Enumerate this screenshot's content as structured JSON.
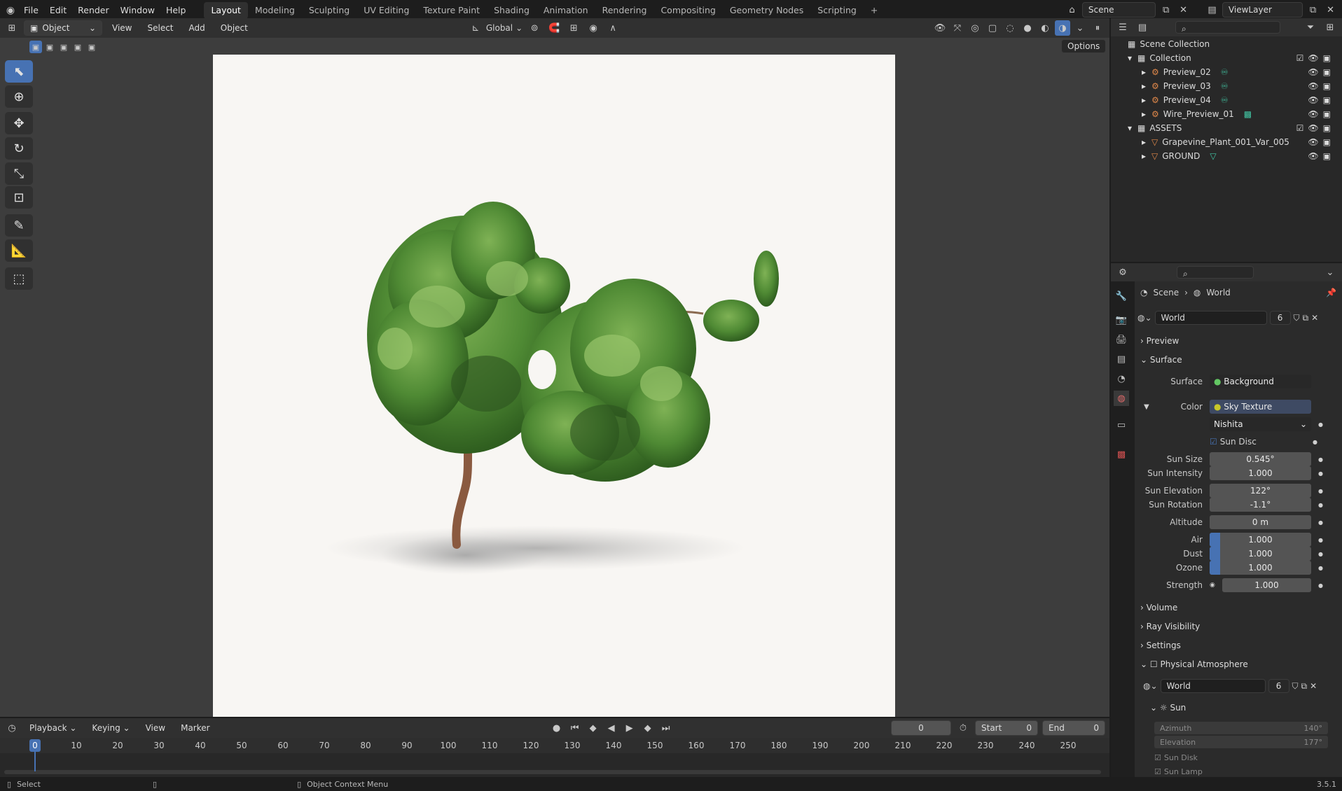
{
  "menu": {
    "file": "File",
    "edit": "Edit",
    "render": "Render",
    "window": "Window",
    "help": "Help"
  },
  "workspaces": [
    "Layout",
    "Modeling",
    "Sculpting",
    "UV Editing",
    "Texture Paint",
    "Shading",
    "Animation",
    "Rendering",
    "Compositing",
    "Geometry Nodes",
    "Scripting"
  ],
  "active_workspace": "Layout",
  "scene_name": "Scene",
  "view_layer": "ViewLayer",
  "viewport_header": {
    "mode": "Object Mode",
    "view": "View",
    "select": "Select",
    "add": "Add",
    "object": "Object",
    "orientation": "Global",
    "options": "Options"
  },
  "outliner": {
    "scene_collection": "Scene Collection",
    "items": [
      {
        "label": "Collection",
        "level": 1
      },
      {
        "label": "Preview_02",
        "level": 2
      },
      {
        "label": "Preview_03",
        "level": 2
      },
      {
        "label": "Preview_04",
        "level": 2
      },
      {
        "label": "Wire_Preview_01",
        "level": 2
      },
      {
        "label": "ASSETS",
        "level": 1
      },
      {
        "label": "Grapevine_Plant_001_Var_005",
        "level": 2
      },
      {
        "label": "GROUND",
        "level": 2
      }
    ]
  },
  "properties": {
    "breadcrumb_scene": "Scene",
    "breadcrumb_world": "World",
    "world_name": "World",
    "world_users": "6",
    "preview": "Preview",
    "surface_section": "Surface",
    "surface_label": "Surface",
    "surface_value": "Background",
    "color_label": "Color",
    "color_value": "Sky Texture",
    "sky_type": "Nishita",
    "sun_disc": "Sun Disc",
    "rows": [
      {
        "label": "Sun Size",
        "value": "0.545°",
        "fill": 0
      },
      {
        "label": "Sun Intensity",
        "value": "1.000",
        "fill": 0
      },
      {
        "label": "Sun Elevation",
        "value": "122°",
        "fill": 0
      },
      {
        "label": "Sun Rotation",
        "value": "-1.1°",
        "fill": 0
      },
      {
        "label": "Altitude",
        "value": "0 m",
        "fill": 0
      },
      {
        "label": "Air",
        "value": "1.000",
        "fill": 0.1
      },
      {
        "label": "Dust",
        "value": "1.000",
        "fill": 0.1
      },
      {
        "label": "Ozone",
        "value": "1.000",
        "fill": 0.1
      }
    ],
    "strength_label": "Strength",
    "strength_value": "1.000",
    "volume": "Volume",
    "ray_visibility": "Ray Visibility",
    "settings": "Settings",
    "physical_atmosphere": "Physical Atmosphere",
    "pa_world": "World",
    "pa_users": "6",
    "sun": "Sun",
    "azimuth_label": "Azimuth",
    "azimuth_value": "140°",
    "elevation_label": "Elevation",
    "elevation_value": "177°",
    "sun_disk": "Sun Disk",
    "sun_lamp": "Sun Lamp"
  },
  "timeline": {
    "playback": "Playback",
    "keying": "Keying",
    "view": "View",
    "marker": "Marker",
    "current_frame": "0",
    "start_label": "Start",
    "start": "0",
    "end_label": "End",
    "end": "0",
    "ticks": [
      "0",
      "10",
      "20",
      "30",
      "40",
      "50",
      "60",
      "70",
      "80",
      "90",
      "100",
      "110",
      "120",
      "130",
      "140",
      "150",
      "160",
      "170",
      "180",
      "190",
      "200",
      "210",
      "220",
      "230",
      "240",
      "250"
    ]
  },
  "statusbar": {
    "select": "Select",
    "context_menu": "Object Context Menu",
    "version": "3.5.1"
  },
  "colors": {
    "accent": "#4772b3",
    "panel": "#303030",
    "bg": "#1d1d1d",
    "viewport": "#3d3d3d",
    "camera_bg": "#f8f6f3"
  }
}
